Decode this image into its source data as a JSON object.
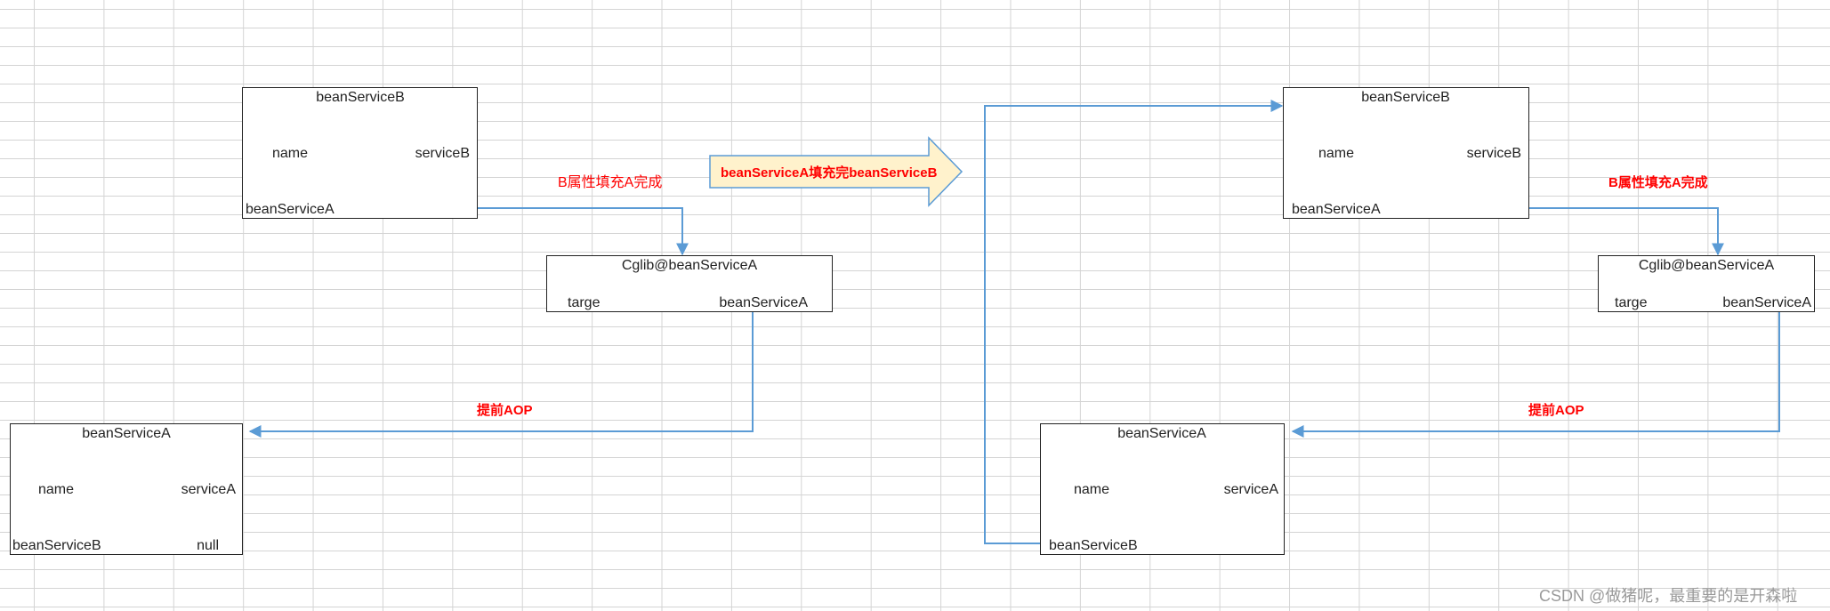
{
  "left": {
    "bean_b": {
      "title": "beanServiceB",
      "name_label": "name",
      "name_value": "serviceB",
      "field_label": "beanServiceA"
    },
    "cglib": {
      "title": "Cglib@beanServiceA",
      "field_label": "targe",
      "field_value": "beanServiceA"
    },
    "bean_a": {
      "title": "beanServiceA",
      "name_label": "name",
      "name_value": "serviceA",
      "field_label": "beanServiceB",
      "field_value": "null"
    },
    "fill_label": "B属性填充A完成",
    "aop_label": "提前AOP"
  },
  "transition_label": "beanServiceA填充完beanServiceB",
  "right": {
    "bean_b": {
      "title": "beanServiceB",
      "name_label": "name",
      "name_value": "serviceB",
      "field_label": "beanServiceA"
    },
    "cglib": {
      "title": "Cglib@beanServiceA",
      "field_label": "targe",
      "field_value": "beanServiceA"
    },
    "bean_a": {
      "title": "beanServiceA",
      "name_label": "name",
      "name_value": "serviceA",
      "field_label": "beanServiceB"
    },
    "fill_label": "B属性填充A完成",
    "aop_label": "提前AOP"
  },
  "watermark": "CSDN @做猪呢，最重要的是开森啦",
  "colors": {
    "connector": "#5b9bd5",
    "label_red": "#ff0000",
    "arrow_fill": "#fff2cc",
    "arrow_stroke": "#5b9bd5"
  }
}
